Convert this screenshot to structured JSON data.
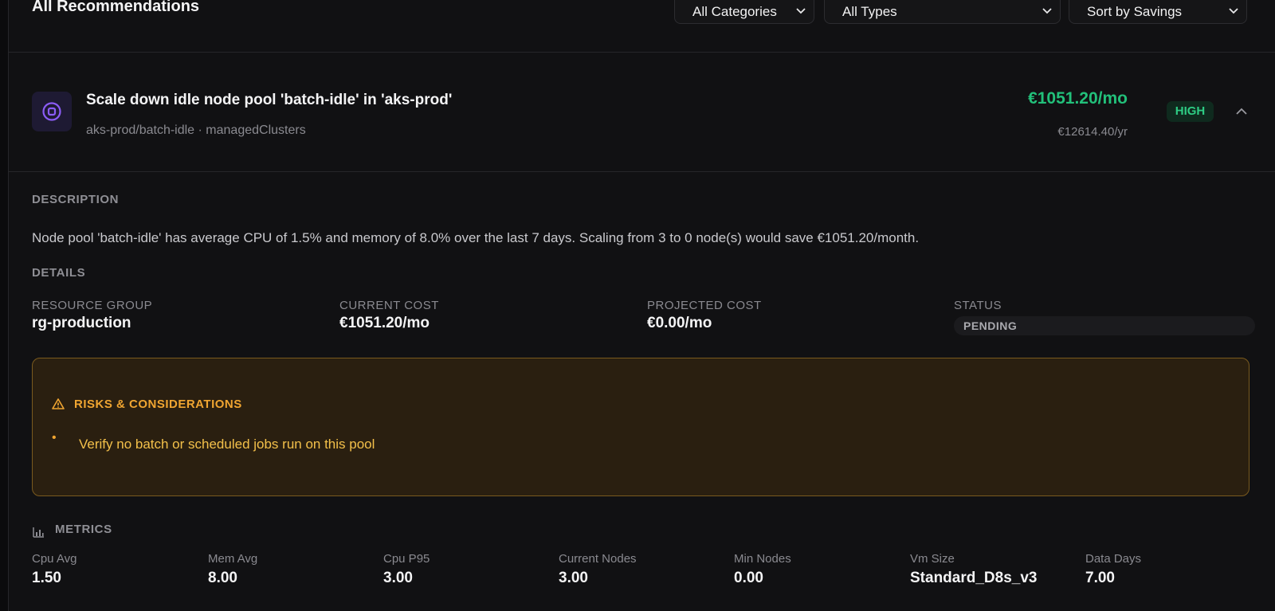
{
  "header": {
    "title": "All Recommendations",
    "filters": {
      "category": "All Categories",
      "type": "All Types",
      "sort": "Sort by Savings"
    }
  },
  "recommendation": {
    "title": "Scale down idle node pool 'batch-idle' in 'aks-prod'",
    "subtitle": "aks-prod/batch-idle · managedClusters",
    "monthly_savings": "€1051.20/mo",
    "yearly_savings": "€12614.40/yr",
    "impact": "HIGH",
    "icon": "target-icon",
    "description_label": "DESCRIPTION",
    "description": "Node pool 'batch-idle' has average CPU of 1.5% and memory of 8.0% over the last 7 days. Scaling from 3 to 0 node(s) would save €1051.20/month.",
    "details_label": "DETAILS",
    "details": [
      {
        "label": "RESOURCE GROUP",
        "value": "rg-production"
      },
      {
        "label": "CURRENT COST",
        "value": "€1051.20/mo"
      },
      {
        "label": "PROJECTED COST",
        "value": "€0.00/mo"
      },
      {
        "label": "STATUS",
        "value": "PENDING"
      }
    ],
    "risks": {
      "title": "RISKS & CONSIDERATIONS",
      "items": [
        "Verify no batch or scheduled jobs run on this pool"
      ]
    },
    "metrics_label": "METRICS",
    "metrics": [
      {
        "label": "Cpu Avg",
        "value": "1.50"
      },
      {
        "label": "Mem Avg",
        "value": "8.00"
      },
      {
        "label": "Cpu P95",
        "value": "3.00"
      },
      {
        "label": "Current Nodes",
        "value": "3.00"
      },
      {
        "label": "Min Nodes",
        "value": "0.00"
      },
      {
        "label": "Vm Size",
        "value": "Standard_D8s_v3"
      },
      {
        "label": "Data Days",
        "value": "7.00"
      }
    ]
  },
  "colors": {
    "background": "#111113",
    "savings": "#22c07a",
    "warning": "#f0a531",
    "icon_accent": "#8b5cf6"
  }
}
